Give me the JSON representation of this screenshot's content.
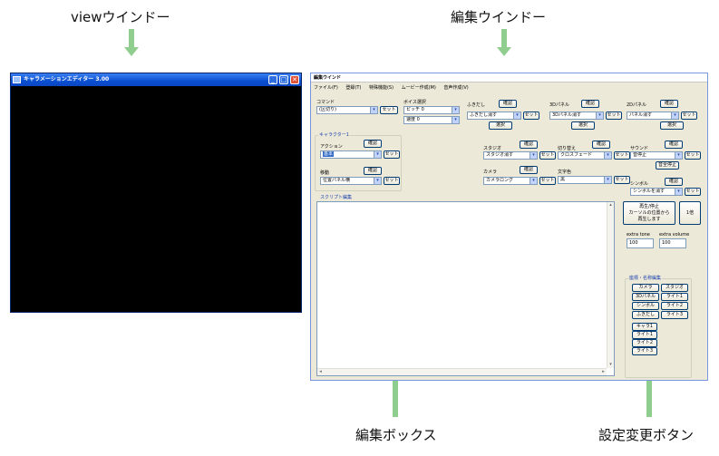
{
  "annotations": {
    "view_window": "viewウインドー",
    "edit_window": "編集ウインドー",
    "edit_box": "編集ボックス",
    "settings_buttons": "設定変更ボタン"
  },
  "view_window": {
    "title": "キャラメーションエディター 3.00",
    "controls": [
      "_",
      "□",
      "✕"
    ]
  },
  "editor": {
    "title": "編集ウインド",
    "menu": [
      "ファイル(F)",
      "登録(T)",
      "特殊機能(S)",
      "ムービー作成(M)",
      "音声作成(V)"
    ],
    "command": {
      "label": "コマンド",
      "value": "(区切り)",
      "set": "セット"
    },
    "voice": {
      "label": "ボイス選択",
      "pitch": "ピッチ 0",
      "speed": "速度 0"
    },
    "fukidashi": {
      "label": "ふきだし",
      "confirm": "確認",
      "value": "ふきだし消す",
      "set": "セット",
      "select": "選択"
    },
    "panel3d": {
      "label": "3Dパネル",
      "confirm": "確認",
      "value": "3Dパネル消す",
      "set": "セット",
      "select": "選択"
    },
    "panel2d": {
      "label": "2Dパネル",
      "confirm": "確認",
      "value": "パネル消す",
      "set": "セット",
      "select": "選択"
    },
    "character_group": {
      "label": "キャラクター1"
    },
    "action": {
      "label": "アクション",
      "confirm": "確認",
      "value": "基本",
      "set": "セット"
    },
    "move": {
      "label": "移動",
      "confirm": "確認",
      "value": "位置パネル横",
      "set": "セット"
    },
    "studio": {
      "label": "スタジオ",
      "confirm": "確認",
      "value": "スタジオ消す",
      "set": "セット"
    },
    "switch": {
      "label": "切り替え",
      "confirm": "確認",
      "value": "クロスフェード",
      "set": "セット"
    },
    "sound": {
      "label": "サウンド",
      "confirm": "確認",
      "value": "音停止",
      "set": "セット",
      "all_stop": "音全停止"
    },
    "camera": {
      "label": "カメラ",
      "confirm": "確認",
      "value": "カメラロング",
      "set": "セット"
    },
    "text_color": {
      "label": "文字色",
      "value": "黒",
      "set": "セット"
    },
    "symbol": {
      "label": "シンボル",
      "confirm": "確認",
      "value": "シンボルを消す",
      "set": "セット"
    },
    "script": {
      "label": "スクリプト編集"
    },
    "playback": {
      "play_line1": "再生/停止",
      "play_line2": "カーソルの位置から",
      "play_line3": "再生します",
      "speed": "1倍"
    },
    "extra_tone": {
      "label": "extra tone",
      "value": "100"
    },
    "extra_volume": {
      "label": "extra volume",
      "value": "100"
    },
    "coords": {
      "label": "座標・名称編集",
      "buttons": [
        "カメラ",
        "スタジオ",
        "3Dパネル",
        "ライト1",
        "シンボル",
        "ライト2",
        "ふきだし",
        "ライト3"
      ],
      "list": [
        "キャラ1",
        "ライト1",
        "ライト2",
        "ライト3"
      ]
    }
  }
}
